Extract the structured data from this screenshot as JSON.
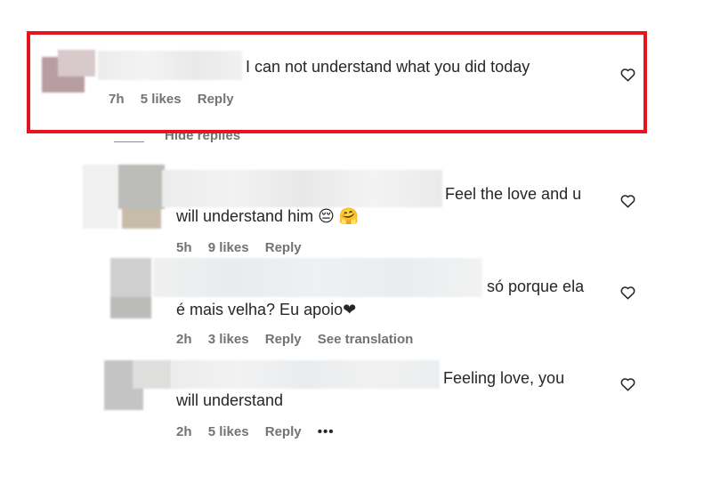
{
  "comments": [
    {
      "text_line1": "I can not understand what you did today",
      "time": "7h",
      "likes": "5 likes",
      "reply": "Reply"
    },
    {
      "text_line1": "Feel the love and u",
      "text_line2": "will understand him 😔 🤗",
      "time": "5h",
      "likes": "9 likes",
      "reply": "Reply"
    },
    {
      "text_line1": "só porque ela",
      "text_line2": "é mais velha? Eu apoio❤",
      "time": "2h",
      "likes": "3 likes",
      "reply": "Reply",
      "translate": "See translation"
    },
    {
      "text_line1": "Feeling love, you",
      "text_line2": "will understand",
      "time": "2h",
      "likes": "5 likes",
      "reply": "Reply",
      "more": "•••"
    }
  ],
  "replies_toggle": "Hide replies",
  "colors": {
    "highlight": "#e8141b",
    "meta": "#737373",
    "text": "#262626"
  }
}
